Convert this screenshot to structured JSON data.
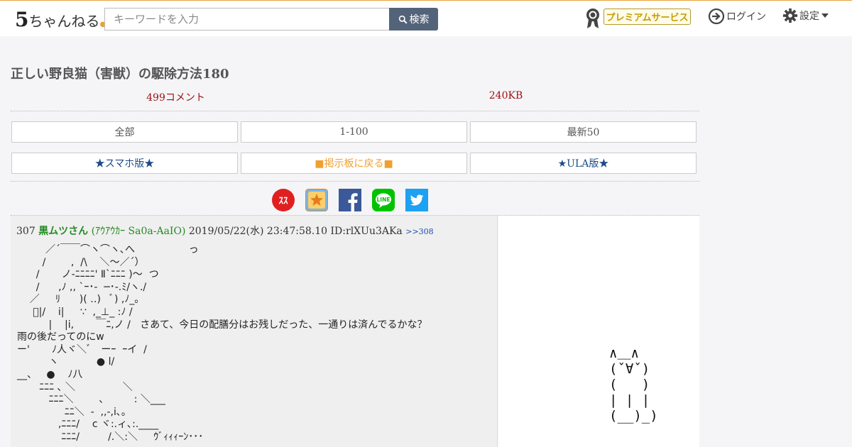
{
  "header": {
    "logo_num": "5",
    "logo_text": "ちゃんねる",
    "search_placeholder": "キーワードを入力",
    "search_button": "検索",
    "premium_label": "プレミアムサービス",
    "login_label": "ログイン",
    "settings_label": "設定"
  },
  "thread": {
    "title": "正しい野良猫（害獣）の駆除方法180",
    "comments": "499コメント",
    "size": "240KB"
  },
  "nav": {
    "all": "全部",
    "range": "1-100",
    "latest": "最新50",
    "sp": "★スマホ版★",
    "back": "■掲示板に戻る■",
    "ula": "★ULA版★"
  },
  "social": [
    {
      "name": "5ch-sukusuku-icon",
      "color": "#e02020"
    },
    {
      "name": "bookmark-star-icon",
      "color": "#f5a623"
    },
    {
      "name": "facebook-icon",
      "color": "#3b5998"
    },
    {
      "name": "line-icon",
      "color": "#00c300"
    },
    {
      "name": "twitter-icon",
      "color": "#1da1f2"
    }
  ],
  "post": {
    "num": "307",
    "name": "黒ムツさん",
    "trip": "(ｱｳｱｳｶｰ Sa0a-AaIO)",
    "date": "2019/05/22(水) 23:47:58.10",
    "id": "ID:rlXUu3AKa",
    "ref": ">>308",
    "aa_lines": [
      "         ／´￣￣⌒ヽ⌒ヽ､へ                 っ",
      "        /        ,  /\\    ＼〜／´）",
      "      /       ノ-ﾆﾆﾆﾆ' Ⅱ`ﾆﾆﾆ )〜  つ",
      "      /      ,ﾉ ,, `ｰ･-  ─･-.ﾐ/ヽ./",
      "    ／     ﾘ      )( ‥)   ﾞ) ,ﾉ_｡",
      "     ﾞ|/    i|     ∵  ,_⊥_ :ﾉ /",
      "          |    |i,       ￣ﾆ,ノ /   さあて、今日の配膳分はお残しだった、一通りは済んでるかな？",
      "雨の後だってのにw",
      "ー'       ﾉ人ヾ＼ﾞ   ーｰ  ｰイ  /",
      "          ヽ            ● l/",
      "__、   ●    ﾉ八",
      "       ﾆﾆﾆ ､ ＼               ＼",
      "          ﾆﾆﾆ＼        、        : ＼___",
      "               ﾆﾆ＼  -  ,,-,i､｡",
      "             ,ﾆﾆﾆ/    c ヾ:.ィ､:.____",
      "              ﾆﾆﾆ/         /.＼:＼     ｳﾞｨｨｨｰﾝ･･･"
    ]
  },
  "ad": {
    "cat_lines": [
      "∧＿∧",
      "(ˇ∀ˇ)",
      "(   )",
      "| | |",
      "(__)_)"
    ]
  }
}
